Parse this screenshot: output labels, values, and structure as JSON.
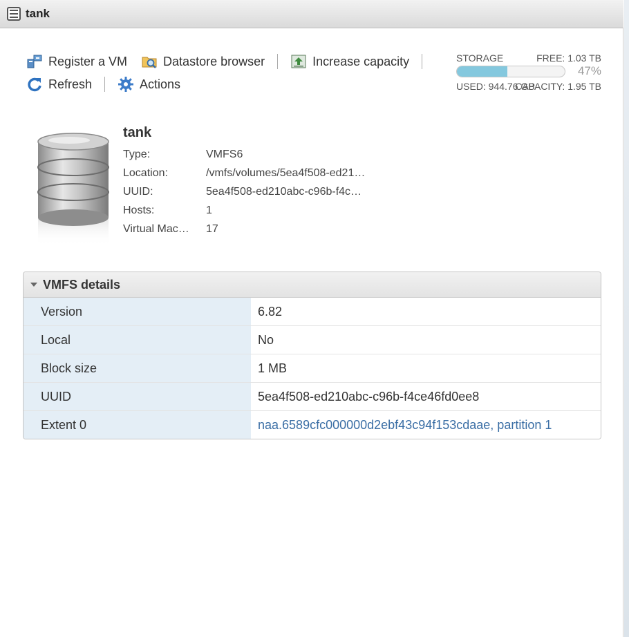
{
  "window": {
    "title": "tank",
    "icon": "datastore-icon"
  },
  "toolbar": {
    "register_vm": "Register a VM",
    "datastore_browser": "Datastore browser",
    "increase_capacity": "Increase capacity",
    "refresh": "Refresh",
    "actions": "Actions"
  },
  "storage": {
    "label": "STORAGE",
    "free": "FREE: 1.03 TB",
    "percent": "47%",
    "used_fraction": 0.47,
    "used": "USED: 944.76 GB",
    "capacity": "CAPACITY: 1.95 TB",
    "fill_color": "#84c8de"
  },
  "datastore": {
    "name": "tank",
    "fields": [
      {
        "label": "Type:",
        "value": "VMFS6"
      },
      {
        "label": "Location:",
        "value": "/vmfs/volumes/5ea4f508-ed21…"
      },
      {
        "label": "UUID:",
        "value": "5ea4f508-ed210abc-c96b-f4c…"
      },
      {
        "label": "Hosts:",
        "value": "1"
      },
      {
        "label": "Virtual Mac…",
        "value": "17"
      }
    ]
  },
  "vmfs_details": {
    "title": "VMFS details",
    "rows": [
      {
        "key": "Version",
        "value": "6.82"
      },
      {
        "key": "Local",
        "value": "No"
      },
      {
        "key": "Block size",
        "value": "1 MB"
      },
      {
        "key": "UUID",
        "value": "5ea4f508-ed210abc-c96b-f4ce46fd0ee8"
      },
      {
        "key": "Extent 0",
        "value": "naa.6589cfc000000d2ebf43c94f153cdaae, partition 1"
      }
    ]
  }
}
